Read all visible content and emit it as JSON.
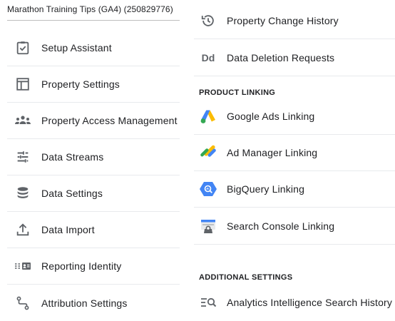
{
  "property": {
    "name": "Marathon Training Tips (GA4) (250829776)"
  },
  "left_menu": [
    {
      "label": "Setup Assistant",
      "icon": "checklist-icon"
    },
    {
      "label": "Property Settings",
      "icon": "property-layout-icon"
    },
    {
      "label": "Property Access Management",
      "icon": "people-group-icon"
    },
    {
      "label": "Data Streams",
      "icon": "data-streams-icon"
    },
    {
      "label": "Data Settings",
      "icon": "database-icon"
    },
    {
      "label": "Data Import",
      "icon": "upload-icon"
    },
    {
      "label": "Reporting Identity",
      "icon": "reporting-identity-icon"
    },
    {
      "label": "Attribution Settings",
      "icon": "attribution-path-icon"
    }
  ],
  "right_menu": {
    "top_items": [
      {
        "label": "Property Change History",
        "icon": "history-icon"
      },
      {
        "label": "Data Deletion Requests",
        "icon": "dd-icon",
        "icon_text": "Dd"
      }
    ],
    "product_linking": {
      "heading": "PRODUCT LINKING",
      "items": [
        {
          "label": "Google Ads Linking",
          "icon": "google-ads-logo-icon"
        },
        {
          "label": "Ad Manager Linking",
          "icon": "ad-manager-logo-icon"
        },
        {
          "label": "BigQuery Linking",
          "icon": "bigquery-logo-icon"
        },
        {
          "label": "Search Console Linking",
          "icon": "search-console-logo-icon"
        }
      ]
    },
    "additional_settings": {
      "heading": "ADDITIONAL SETTINGS",
      "items": [
        {
          "label": "Analytics Intelligence Search History",
          "icon": "search-history-icon"
        }
      ]
    }
  },
  "colors": {
    "icon_gray": "#5f6368",
    "divider": "#e8eaed",
    "google_blue": "#4285f4",
    "google_yellow": "#fbbc04",
    "google_green": "#34a853"
  }
}
